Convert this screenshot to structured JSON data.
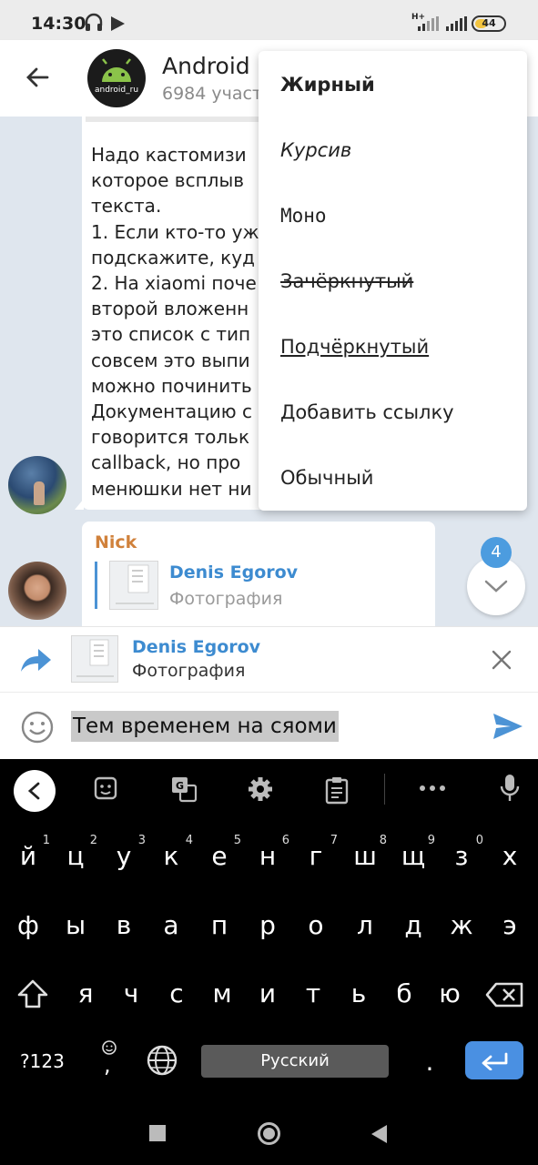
{
  "status": {
    "time": "14:30",
    "network": "H+",
    "battery": "44",
    "battery_level": 0.44
  },
  "header": {
    "title": "Android I",
    "subtitle": "6984 участ",
    "avatar_text": "android_ru"
  },
  "messages": {
    "first_text": "Надо кастомизи\nкоторое всплыв\nтекста.\n1. Если кто-то уж\nподскажите, куд\n2. На xiaomi поче\nвторой вложенн\nэто список с тип\nсовсем это выпи\nможно починить\nДокументацию с\nговорится тольк\ncallback, но про \nменюшки нет ни",
    "second": {
      "author": "Nick",
      "reply_name": "Denis Egorov",
      "reply_type": "Фотография"
    },
    "unread_badge": "4"
  },
  "context_menu": {
    "items": [
      "Жирный",
      "Курсив",
      "Моно",
      "Зачёркнутый",
      "Подчёркнутый",
      "Добавить ссылку",
      "Обычный"
    ]
  },
  "reply_panel": {
    "name": "Denis Egorov",
    "type": "Фотография"
  },
  "input": {
    "value": "Тем временем на сяоми"
  },
  "keyboard": {
    "row1": [
      "й",
      "ц",
      "у",
      "к",
      "е",
      "н",
      "г",
      "ш",
      "щ",
      "з",
      "х"
    ],
    "row1_hints": [
      "1",
      "2",
      "3",
      "4",
      "5",
      "6",
      "7",
      "8",
      "9",
      "0",
      ""
    ],
    "row2": [
      "ф",
      "ы",
      "в",
      "а",
      "п",
      "р",
      "о",
      "л",
      "д",
      "ж",
      "э"
    ],
    "row3": [
      "я",
      "ч",
      "с",
      "м",
      "и",
      "т",
      "ь",
      "б",
      "ю"
    ],
    "num_key": "?123",
    "comma": ",",
    "space_label": "Русский",
    "period": "."
  },
  "colors": {
    "accent": "#4c93d5",
    "author": "#d0813b",
    "enter": "#4a90e2"
  }
}
